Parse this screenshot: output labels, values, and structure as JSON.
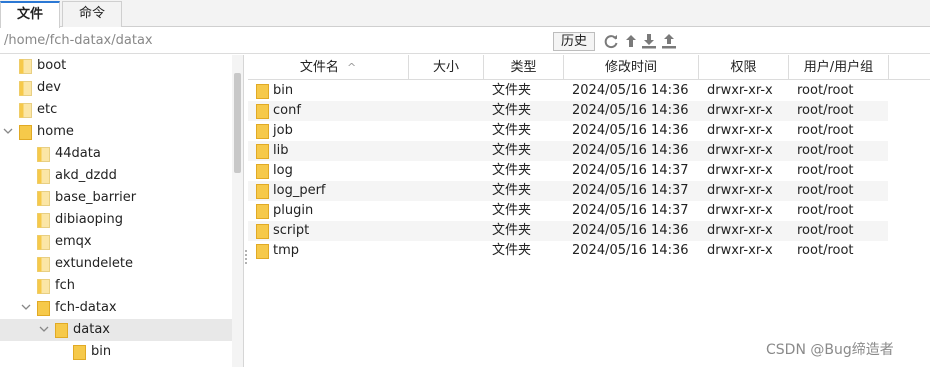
{
  "tabs": [
    {
      "label": "文件",
      "active": true
    },
    {
      "label": "命令",
      "active": false
    }
  ],
  "path": {
    "value": "/home/fch-datax/datax",
    "history_label": "历史"
  },
  "toolbar_icons": [
    "refresh-icon",
    "upload-arrow-icon",
    "download-icon",
    "upload-icon"
  ],
  "tree": [
    {
      "label": "boot",
      "level": 1
    },
    {
      "label": "dev",
      "level": 1
    },
    {
      "label": "etc",
      "level": 1
    },
    {
      "label": "home",
      "level": 1,
      "expanded": true
    },
    {
      "label": "44data",
      "level": 2
    },
    {
      "label": "akd_dzdd",
      "level": 2
    },
    {
      "label": "base_barrier",
      "level": 2
    },
    {
      "label": "dibiaoping",
      "level": 2
    },
    {
      "label": "emqx",
      "level": 2
    },
    {
      "label": "extundelete",
      "level": 2
    },
    {
      "label": "fch",
      "level": 2
    },
    {
      "label": "fch-datax",
      "level": 2,
      "expanded": true
    },
    {
      "label": "datax",
      "level": 3,
      "expanded": true,
      "selected": true
    },
    {
      "label": "bin",
      "level": 4
    }
  ],
  "columns": [
    "文件名",
    "大小",
    "类型",
    "修改时间",
    "权限",
    "用户/用户组"
  ],
  "sort_indicator": "^",
  "files": [
    {
      "name": "bin",
      "size": "",
      "type": "文件夹",
      "mtime": "2024/05/16 14:36",
      "perm": "drwxr-xr-x",
      "owner": "root/root"
    },
    {
      "name": "conf",
      "size": "",
      "type": "文件夹",
      "mtime": "2024/05/16 14:36",
      "perm": "drwxr-xr-x",
      "owner": "root/root"
    },
    {
      "name": "job",
      "size": "",
      "type": "文件夹",
      "mtime": "2024/05/16 14:36",
      "perm": "drwxr-xr-x",
      "owner": "root/root"
    },
    {
      "name": "lib",
      "size": "",
      "type": "文件夹",
      "mtime": "2024/05/16 14:36",
      "perm": "drwxr-xr-x",
      "owner": "root/root"
    },
    {
      "name": "log",
      "size": "",
      "type": "文件夹",
      "mtime": "2024/05/16 14:37",
      "perm": "drwxr-xr-x",
      "owner": "root/root"
    },
    {
      "name": "log_perf",
      "size": "",
      "type": "文件夹",
      "mtime": "2024/05/16 14:37",
      "perm": "drwxr-xr-x",
      "owner": "root/root"
    },
    {
      "name": "plugin",
      "size": "",
      "type": "文件夹",
      "mtime": "2024/05/16 14:37",
      "perm": "drwxr-xr-x",
      "owner": "root/root"
    },
    {
      "name": "script",
      "size": "",
      "type": "文件夹",
      "mtime": "2024/05/16 14:36",
      "perm": "drwxr-xr-x",
      "owner": "root/root"
    },
    {
      "name": "tmp",
      "size": "",
      "type": "文件夹",
      "mtime": "2024/05/16 14:36",
      "perm": "drwxr-xr-x",
      "owner": "root/root"
    }
  ],
  "watermark": "CSDN @Bug缔造者",
  "colors": {
    "accent": "#2b78d4",
    "folder": "#f6c94a",
    "folder_edge": "#e1aa25",
    "selected_row": "#e8e8e8",
    "icon_gray": "#7a7a7a"
  }
}
